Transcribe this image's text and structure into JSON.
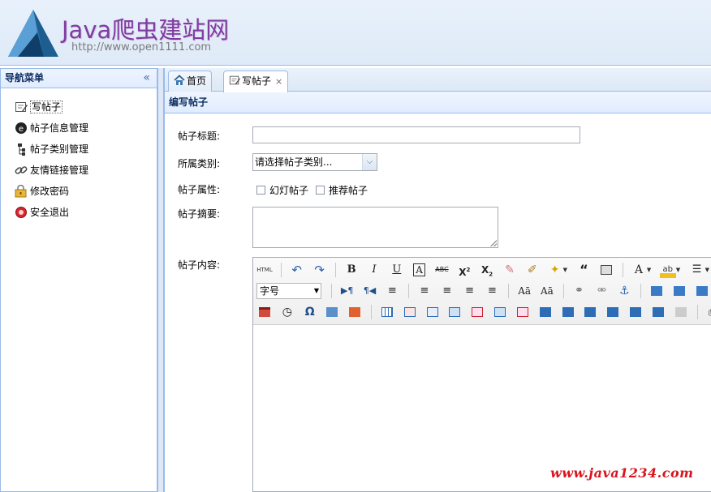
{
  "header": {
    "title": "Java爬虫建站网",
    "url": "http://www.open1111.com"
  },
  "nav": {
    "title": "导航菜单",
    "collapse_icon": "«",
    "items": [
      {
        "label": "写帖子",
        "icon": "edit-icon"
      },
      {
        "label": "帖子信息管理",
        "icon": "info-icon"
      },
      {
        "label": "帖子类别管理",
        "icon": "tree-icon"
      },
      {
        "label": "友情链接管理",
        "icon": "link-icon"
      },
      {
        "label": "修改密码",
        "icon": "lock-icon"
      },
      {
        "label": "安全退出",
        "icon": "exit-icon"
      }
    ]
  },
  "tabs": [
    {
      "label": "首页",
      "icon": "home-icon"
    },
    {
      "label": "写帖子",
      "icon": "edit-icon",
      "close": "×"
    }
  ],
  "panel": {
    "title": "编写帖子"
  },
  "form": {
    "title_label": "帖子标题:",
    "category_label": "所属类别:",
    "category_value": "请选择帖子类别...",
    "attribute_label": "帖子属性:",
    "attr_slide": "幻灯帖子",
    "attr_recommend": "推荐帖子",
    "summary_label": "帖子摘要:",
    "content_label": "帖子内容:"
  },
  "editor": {
    "font_size": "字号"
  },
  "watermark": "www.java1234.com",
  "colors": {
    "border": "#99bbe8",
    "header_bg": "#dfeaf8",
    "logo_text": "#7e3da0",
    "watermark": "#d9141e"
  }
}
